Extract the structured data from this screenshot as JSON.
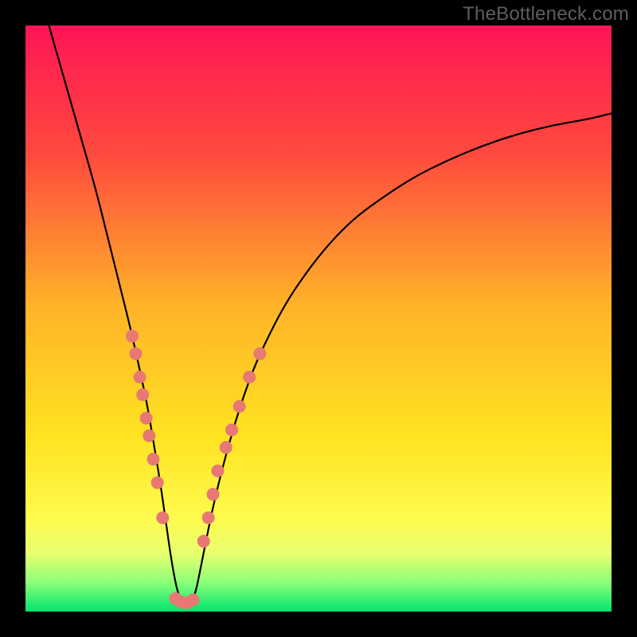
{
  "watermark": "TheBottleneck.com",
  "chart_data": {
    "type": "line",
    "title": "",
    "xlabel": "",
    "ylabel": "",
    "xlim": [
      0,
      100
    ],
    "ylim": [
      0,
      100
    ],
    "gradient_stops": [
      {
        "offset": 0,
        "color": "#ff1556"
      },
      {
        "offset": 22,
        "color": "#ff4a3e"
      },
      {
        "offset": 48,
        "color": "#ffb328"
      },
      {
        "offset": 70,
        "color": "#ffe321"
      },
      {
        "offset": 84,
        "color": "#fffb4e"
      },
      {
        "offset": 90,
        "color": "#e9ff6f"
      },
      {
        "offset": 95,
        "color": "#8cff78"
      },
      {
        "offset": 100,
        "color": "#00e46e"
      }
    ],
    "series": [
      {
        "name": "bottleneck-curve",
        "stroke": "#000000",
        "x": [
          4,
          6,
          8,
          10,
          12,
          14,
          16,
          18,
          20,
          21,
          22,
          23,
          24,
          25,
          26,
          27,
          28,
          29,
          30,
          32,
          34,
          36,
          38,
          40,
          44,
          48,
          52,
          56,
          60,
          66,
          72,
          78,
          84,
          90,
          96,
          100
        ],
        "y": [
          100,
          93,
          86,
          79,
          72,
          64,
          56,
          48,
          39,
          34,
          28,
          22,
          15,
          8,
          3,
          1,
          1,
          3,
          8,
          18,
          26,
          33,
          39,
          44,
          52,
          58,
          63,
          67,
          70,
          74,
          77,
          79.5,
          81.5,
          83,
          84,
          85
        ]
      }
    ],
    "marker_groups": [
      {
        "name": "left-cluster",
        "color": "#e77874",
        "radius": 8,
        "points": [
          {
            "x": 18.2,
            "y": 47
          },
          {
            "x": 18.8,
            "y": 44
          },
          {
            "x": 19.5,
            "y": 40
          },
          {
            "x": 20.0,
            "y": 37
          },
          {
            "x": 20.6,
            "y": 33
          },
          {
            "x": 21.1,
            "y": 30
          },
          {
            "x": 21.8,
            "y": 26
          },
          {
            "x": 22.5,
            "y": 22
          },
          {
            "x": 23.4,
            "y": 16
          }
        ]
      },
      {
        "name": "bottom-cluster",
        "color": "#e77874",
        "radius": 8,
        "points": [
          {
            "x": 25.6,
            "y": 2.2
          },
          {
            "x": 26.6,
            "y": 1.6
          },
          {
            "x": 27.6,
            "y": 1.5
          },
          {
            "x": 28.6,
            "y": 2.0
          }
        ]
      },
      {
        "name": "right-cluster",
        "color": "#e77874",
        "radius": 8,
        "points": [
          {
            "x": 30.4,
            "y": 12
          },
          {
            "x": 31.2,
            "y": 16
          },
          {
            "x": 32.0,
            "y": 20
          },
          {
            "x": 32.8,
            "y": 24
          },
          {
            "x": 34.2,
            "y": 28
          },
          {
            "x": 35.2,
            "y": 31
          },
          {
            "x": 36.5,
            "y": 35
          },
          {
            "x": 38.2,
            "y": 40
          },
          {
            "x": 40.0,
            "y": 44
          }
        ]
      }
    ]
  }
}
